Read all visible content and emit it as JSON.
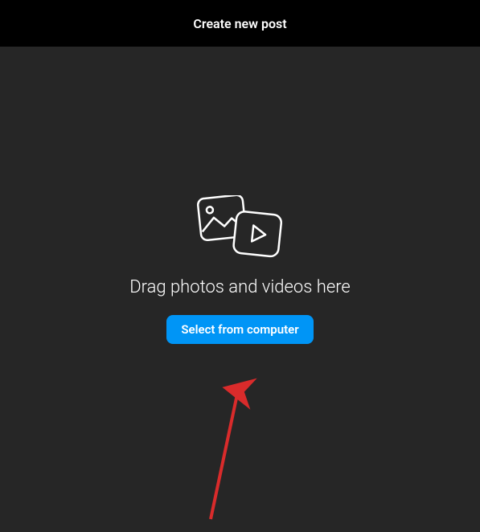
{
  "header": {
    "title": "Create new post"
  },
  "main": {
    "prompt_text": "Drag photos and videos here",
    "select_button_label": "Select from computer"
  },
  "annotation": {
    "arrow_color": "#d92b2b"
  }
}
